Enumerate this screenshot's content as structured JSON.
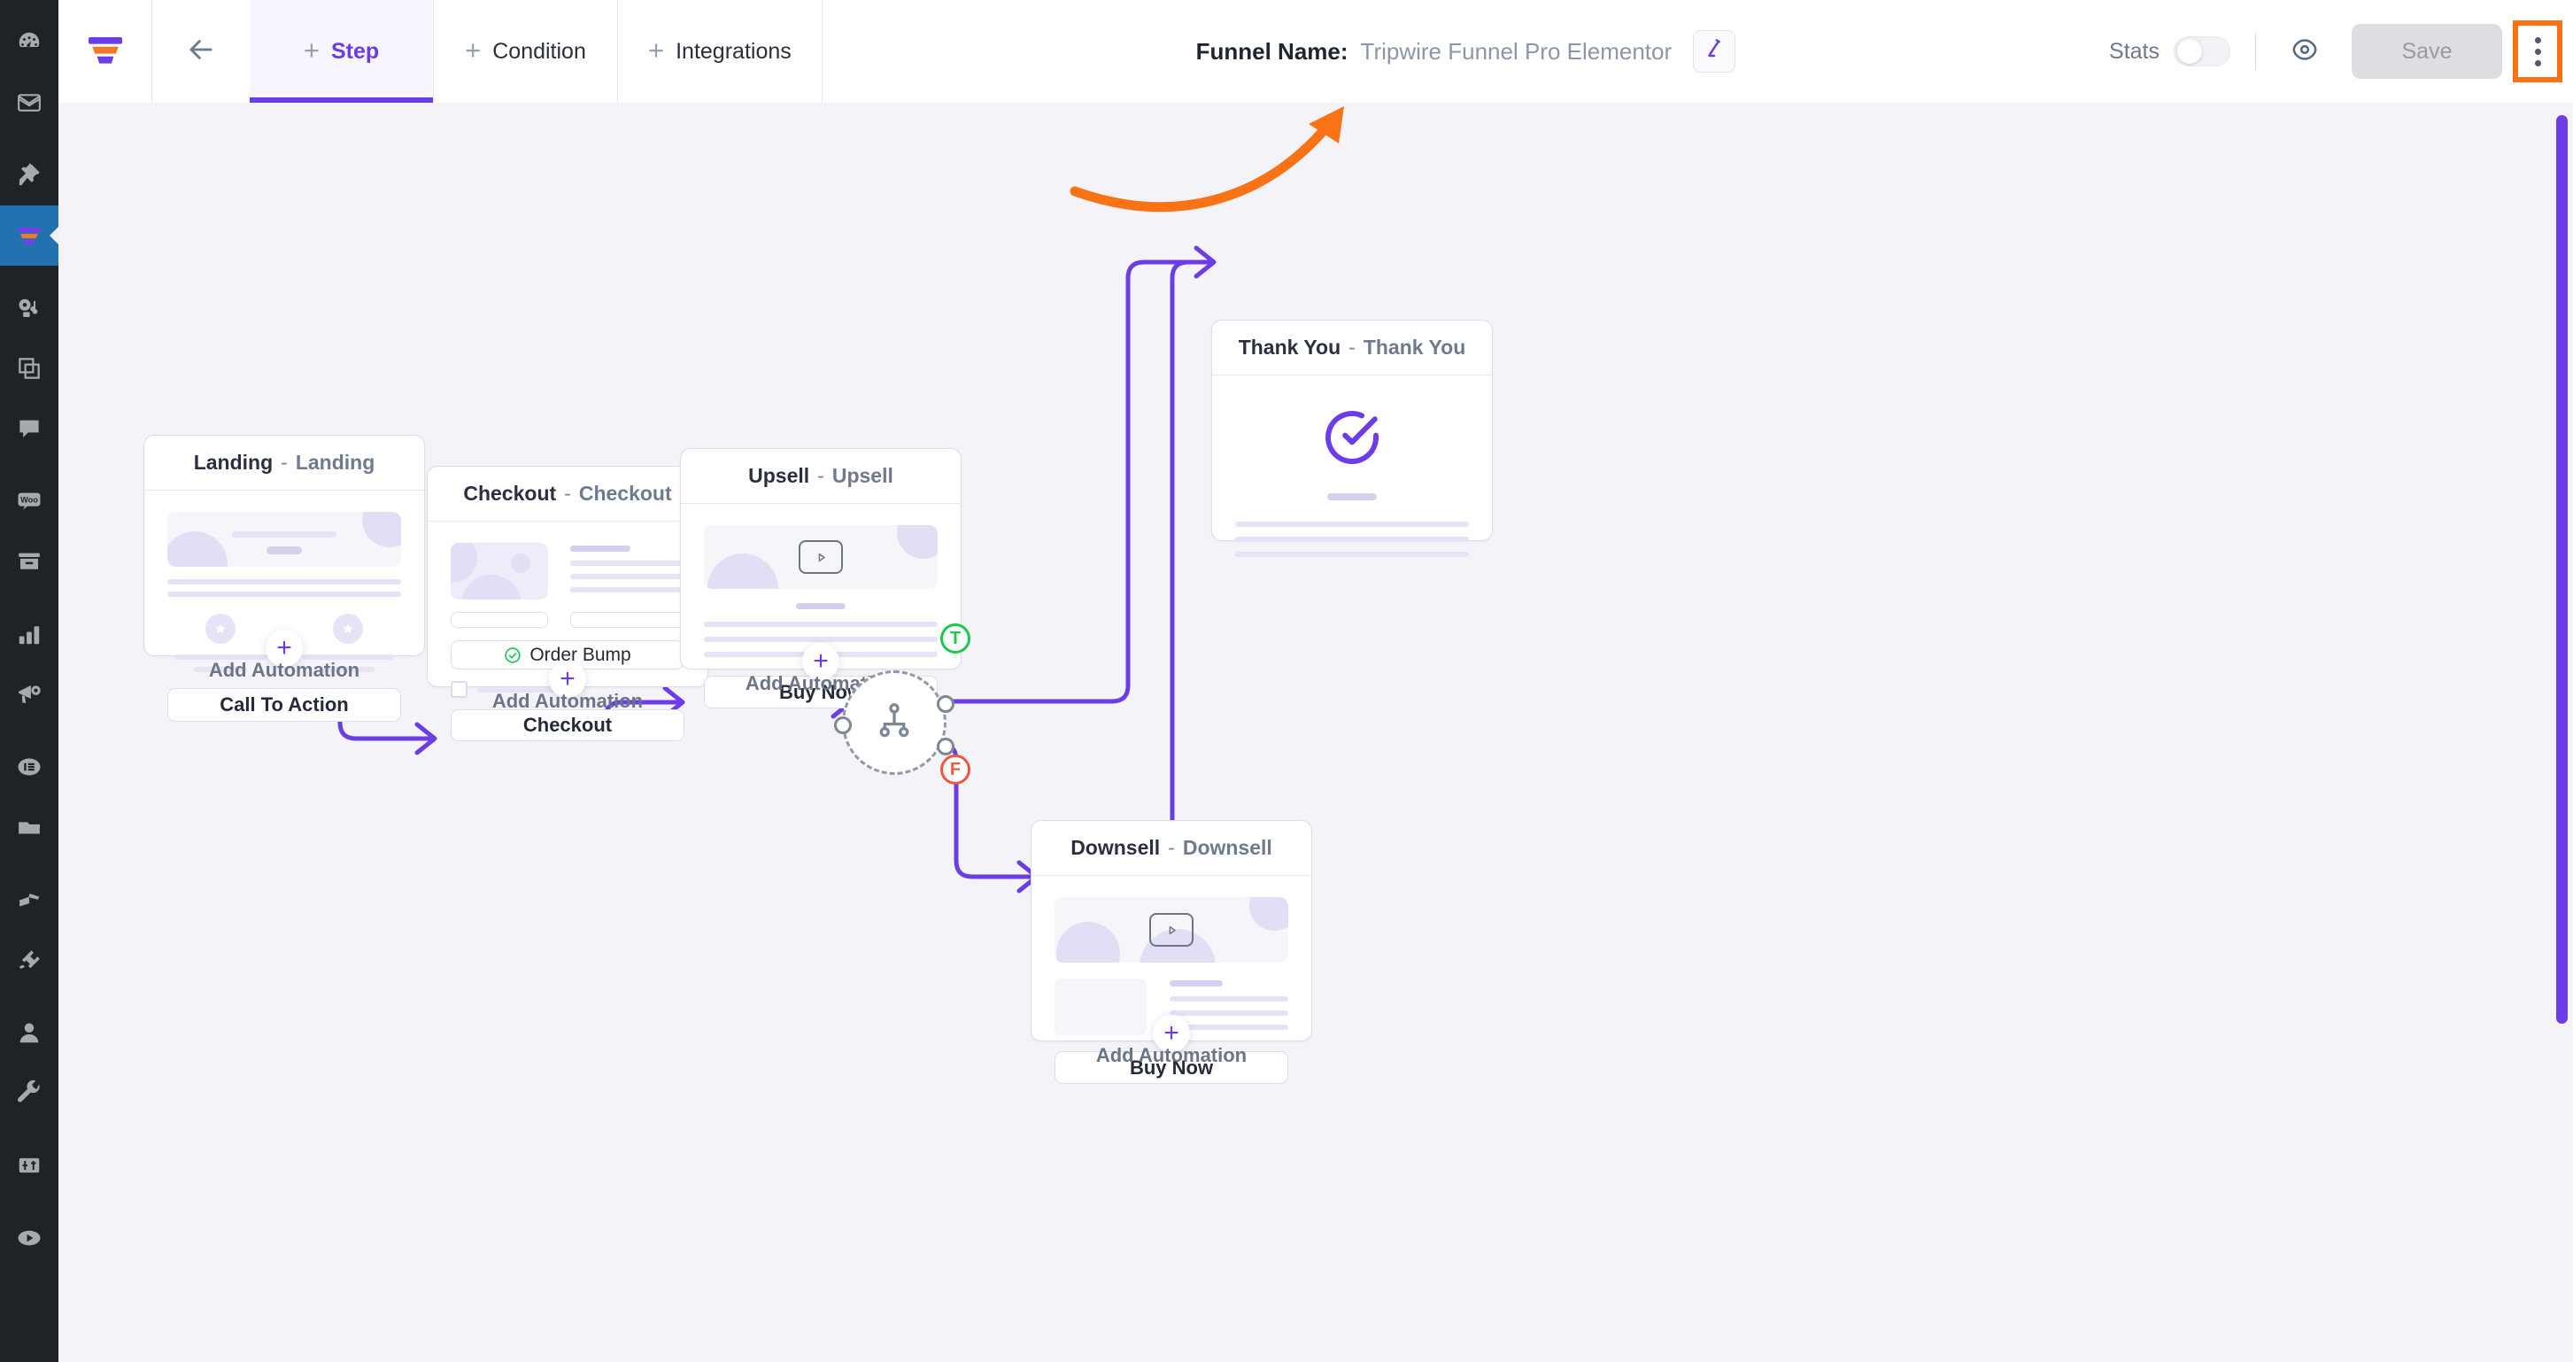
{
  "wp_sidebar": {
    "items": [
      {
        "name": "dashboard",
        "icon": "dashboard-icon",
        "active": false
      },
      {
        "name": "mail",
        "icon": "envelope-icon",
        "active": false
      },
      {
        "name": "pins",
        "icon": "pin-icon",
        "active": false
      },
      {
        "name": "funnels",
        "icon": "funnel-icon",
        "active": true
      },
      {
        "name": "media",
        "icon": "media-icon",
        "active": false
      },
      {
        "name": "pages",
        "icon": "pages-icon",
        "active": false
      },
      {
        "name": "comments",
        "icon": "comment-icon",
        "active": false
      },
      {
        "name": "woocommerce",
        "icon": "woo-icon",
        "active": false
      },
      {
        "name": "products",
        "icon": "archive-icon",
        "active": false
      },
      {
        "name": "analytics",
        "icon": "bar-chart-icon",
        "active": false
      },
      {
        "name": "marketing",
        "icon": "megaphone-icon",
        "active": false
      },
      {
        "name": "elementor",
        "icon": "elementor-icon",
        "active": false
      },
      {
        "name": "templates",
        "icon": "folder-icon",
        "active": false
      },
      {
        "name": "appearance",
        "icon": "paintbrush-icon",
        "active": false
      },
      {
        "name": "plugins",
        "icon": "plug-icon",
        "active": false
      },
      {
        "name": "users",
        "icon": "user-icon",
        "active": false
      },
      {
        "name": "tools",
        "icon": "wrench-icon",
        "active": false
      },
      {
        "name": "settings",
        "icon": "sliders-icon",
        "active": false
      },
      {
        "name": "video",
        "icon": "play-icon",
        "active": false
      }
    ]
  },
  "topbar": {
    "logo_icon": "funnel-logo-icon",
    "back_icon": "arrow-left-icon",
    "tabs": [
      {
        "label": "Step",
        "active": true
      },
      {
        "label": "Condition",
        "active": false
      },
      {
        "label": "Integrations",
        "active": false
      }
    ],
    "funnel_name_label": "Funnel Name:",
    "funnel_name_value": "Tripwire Funnel Pro Elementor",
    "edit_icon": "pencil-icon",
    "stats_label": "Stats",
    "stats_enabled": false,
    "preview_icon": "eye-icon",
    "save_label": "Save",
    "more_icon": "three-dots-vertical-icon"
  },
  "annotation": {
    "highlight_color": "#f97316",
    "target": "more-options-button",
    "arrow_icon": "curved-arrow-icon"
  },
  "canvas": {
    "background_color": "#f4f4f8",
    "edge_color": "#6c3ce9",
    "scrollbar_color": "#6c3ce9",
    "add_automation_label": "Add Automation",
    "plus_glyph": "+"
  },
  "steps": [
    {
      "id": "landing",
      "title": "Landing",
      "subtitle": "Landing",
      "separator": "-",
      "cta_label": "Call To Action",
      "has_automation": true,
      "automation_label": "Add Automation"
    },
    {
      "id": "checkout",
      "title": "Checkout",
      "subtitle": "Checkout",
      "separator": "-",
      "order_bump_label": "Order Bump",
      "order_bump_checked": true,
      "order_bump_color": "#22c55e",
      "cta_label": "Checkout",
      "has_automation": true,
      "automation_label": "Add Automation"
    },
    {
      "id": "upsell",
      "title": "Upsell",
      "subtitle": "Upsell",
      "separator": "-",
      "cta_label": "Buy Now",
      "has_automation": true,
      "automation_label": "Add Automation"
    },
    {
      "id": "downsell",
      "title": "Downsell",
      "subtitle": "Downsell",
      "separator": "-",
      "cta_label": "Buy Now",
      "has_automation": true,
      "automation_label": "Add Automation"
    },
    {
      "id": "thankyou",
      "title": "Thank You",
      "subtitle": "Thank You",
      "separator": "-",
      "has_automation": false
    }
  ],
  "condition_node": {
    "icon": "split-hierarchy-icon",
    "true_label": "T",
    "false_label": "F",
    "true_color": "#1ac94a",
    "false_color": "#f05542"
  }
}
